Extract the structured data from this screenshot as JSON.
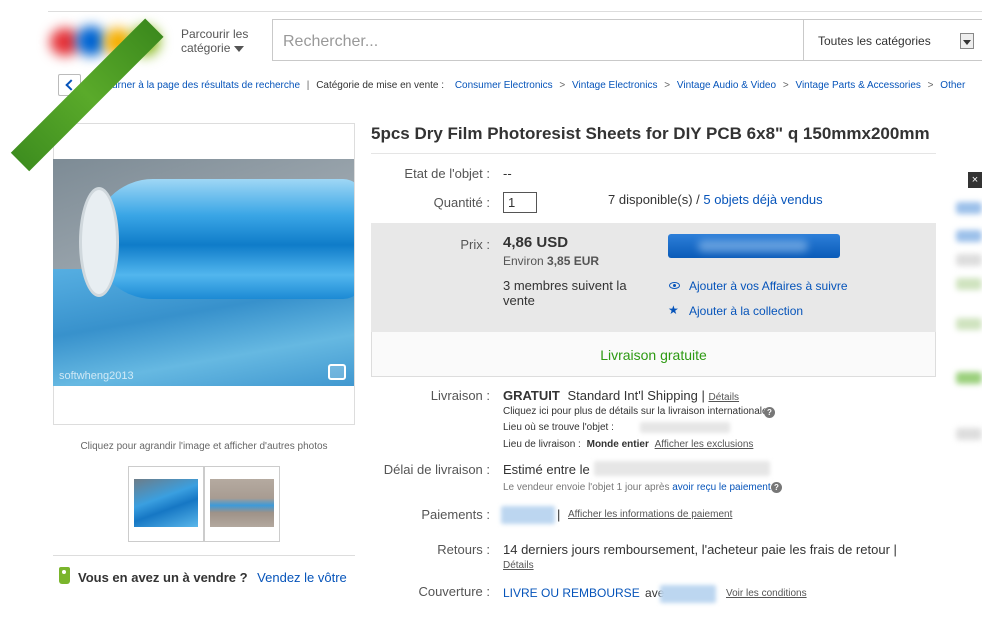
{
  "header": {
    "browse_label_line1": "Parcourir les",
    "browse_label_line2": "catégorie",
    "search_placeholder": "Rechercher...",
    "category_select": "Toutes les catégories"
  },
  "breadcrumb": {
    "back_label": "Retourner à la page des résultats de recherche",
    "category_label": "Catégorie de mise en vente :",
    "items": [
      "Consumer Electronics",
      "Vintage Electronics",
      "Vintage Audio & Video",
      "Vintage Parts & Accessories",
      "Other"
    ]
  },
  "gallery": {
    "watermark": "softwheng2013",
    "caption": "Cliquez pour agrandir l'image et afficher d'autres photos"
  },
  "sell": {
    "question": "Vous en avez un à vendre ?",
    "link": "Vendez le vôtre"
  },
  "item": {
    "title": "5pcs Dry Film Photoresist Sheets for DIY PCB 6x8\" q 150mmx200mm",
    "condition_label": "Etat de l'objet :",
    "condition_value": "--",
    "quantity_label": "Quantité :",
    "quantity_value": "1",
    "available": "7 disponible(s) /",
    "sold_link": "5 objets déjà vendus",
    "price_label": "Prix :",
    "price": "4,86 USD",
    "approx_prefix": "Environ",
    "approx_value": "3,85 EUR",
    "watchers_line1": "3 membres suivent la",
    "watchers_line2": "vente",
    "watch_link": "Ajouter à vos Affaires à suivre",
    "collection_link": "Ajouter à la collection",
    "free_shipping": "Livraison gratuite"
  },
  "shipping": {
    "label": "Livraison :",
    "free": "GRATUIT",
    "method": "Standard Int'l Shipping |",
    "details": "Détails",
    "intl_note": "Cliquez ici pour plus de détails sur la livraison internationale.",
    "location_label": "Lieu où se trouve l'objet :",
    "ships_to_label": "Lieu de livraison :",
    "ships_to_value": "Monde entier",
    "exclusions_link": "Afficher les exclusions"
  },
  "delivery": {
    "label": "Délai de livraison :",
    "estimate": "Estimé entre le",
    "seller_note": "Le vendeur envoie l'objet 1 jour après",
    "payment_received_link": "avoir reçu le paiement",
    "dot": "."
  },
  "payments": {
    "label": "Paiements :",
    "separator": "|",
    "info_link": "Afficher les informations de paiement"
  },
  "returns": {
    "label": "Retours :",
    "text": "14 derniers jours remboursement, l'acheteur paie les frais de retour |",
    "details": "Détails"
  },
  "coverage": {
    "label": "Couverture :",
    "guarantee": "LIVRE OU REMBOURSE",
    "with": "avec",
    "conditions_link": "Voir les conditions"
  },
  "colors": {
    "link": "#0654ba",
    "free_green": "#2d9a12",
    "ribbon_green": "#4a9a24",
    "price_box": "#e8e8e8"
  },
  "icons": [
    "chevron-left-icon",
    "caret-down-icon",
    "eye-icon",
    "star-icon",
    "help-icon",
    "price-tag-icon",
    "expand-photo-icon"
  ]
}
